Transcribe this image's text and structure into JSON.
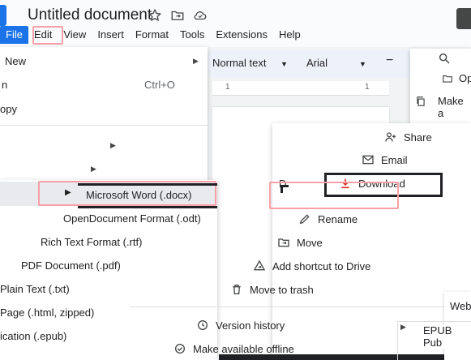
{
  "window": {
    "title": "Untitled document"
  },
  "menubar": {
    "items": [
      "File",
      "Edit",
      "View",
      "Insert",
      "Format",
      "Tools",
      "Extensions",
      "Help"
    ]
  },
  "toolbar": {
    "style": "Normal text",
    "font": "Arial"
  },
  "ruler": {
    "mark1": "1",
    "mark2": "1"
  },
  "file_menu": {
    "items": [
      {
        "label": "New",
        "shortcut": ""
      },
      {
        "label": "n",
        "shortcut": "Ctrl+O"
      },
      {
        "label": "opy",
        "shortcut": ""
      }
    ]
  },
  "download_submenu": {
    "items": [
      "Microsoft Word (.docx)",
      "OpenDocument Format (.odt)",
      "Rich Text Format (.rtf)",
      "PDF Document (.pdf)",
      "Plain Text (.txt)",
      "Page (.html, zipped)",
      "ication (.epub)"
    ]
  },
  "right_menu": {
    "items": [
      "Share",
      "Email",
      "Download",
      "Rename",
      "Move",
      "Add shortcut to Drive",
      "Move to trash",
      "Version history",
      "Make available offline"
    ],
    "prefix": "D"
  },
  "share_panel": {
    "open_label": "Op",
    "make_label": "Make a"
  },
  "far_panel": {
    "web_label": "Web",
    "epub_label": "EPUB Pub"
  },
  "colors": {
    "accent": "#1a73e8",
    "highlight": "#f8a0a8",
    "download_red": "#d93025"
  }
}
